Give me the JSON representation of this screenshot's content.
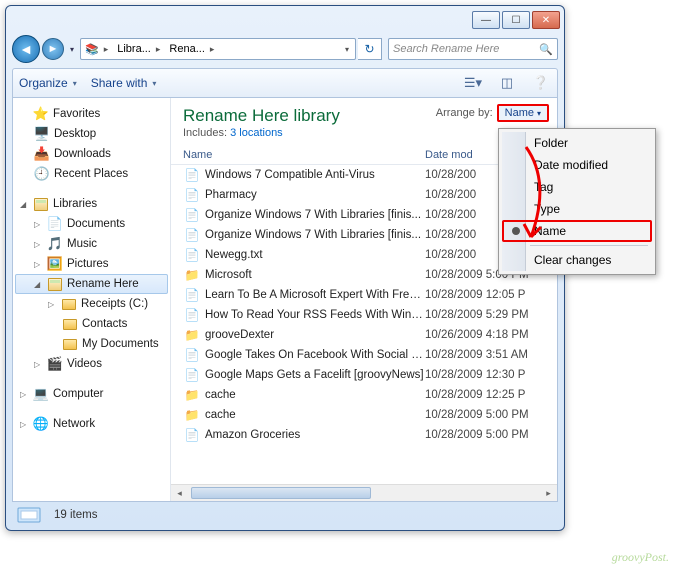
{
  "titlebar": {
    "min": "—",
    "max": "☐",
    "close": "✕"
  },
  "nav": {
    "crumb1": "Libra...",
    "crumb2": "Rena...",
    "search_placeholder": "Search Rename Here"
  },
  "toolbar": {
    "organize": "Organize",
    "share": "Share with"
  },
  "tree": {
    "favorites": "Favorites",
    "desktop": "Desktop",
    "downloads": "Downloads",
    "recent": "Recent Places",
    "libraries": "Libraries",
    "documents": "Documents",
    "music": "Music",
    "pictures": "Pictures",
    "rename_here": "Rename Here",
    "receipts": "Receipts (C:)",
    "contacts": "Contacts",
    "mydocs": "My Documents",
    "videos": "Videos",
    "computer": "Computer",
    "network": "Network"
  },
  "library": {
    "title": "Rename Here library",
    "includes_label": "Includes:",
    "includes_link": "3 locations",
    "arrange_label": "Arrange by:",
    "arrange_value": "Name"
  },
  "columns": {
    "name": "Name",
    "date": "Date mod"
  },
  "files": [
    {
      "name": "Windows 7 Compatible Anti-Virus",
      "date": "10/28/200",
      "icon": "📄"
    },
    {
      "name": "Pharmacy",
      "date": "10/28/200",
      "icon": "📄"
    },
    {
      "name": "Organize Windows 7 With Libraries [finis...",
      "date": "10/28/200",
      "icon": "📄"
    },
    {
      "name": "Organize Windows 7 With Libraries [finis...",
      "date": "10/28/200",
      "icon": "📄"
    },
    {
      "name": "Newegg.txt",
      "date": "10/28/200",
      "icon": "📄"
    },
    {
      "name": "Microsoft",
      "date": "10/28/2009 5:00 PM",
      "icon": "📁"
    },
    {
      "name": "Learn To Be A Microsoft Expert With Free...",
      "date": "10/28/2009 12:05 P",
      "icon": "📄"
    },
    {
      "name": "How To Read Your RSS Feeds With Wind...",
      "date": "10/28/2009 5:29 PM",
      "icon": "📄"
    },
    {
      "name": "grooveDexter",
      "date": "10/26/2009 4:18 PM",
      "icon": "📁"
    },
    {
      "name": "Google Takes On Facebook With Social S...",
      "date": "10/28/2009 3:51 AM",
      "icon": "📄"
    },
    {
      "name": "Google Maps Gets a Facelift [groovyNews]",
      "date": "10/28/2009 12:30 P",
      "icon": "📄"
    },
    {
      "name": "cache",
      "date": "10/28/2009 12:25 P",
      "icon": "📁"
    },
    {
      "name": "cache",
      "date": "10/28/2009 5:00 PM",
      "icon": "📁"
    },
    {
      "name": "Amazon Groceries",
      "date": "10/28/2009 5:00 PM",
      "icon": "📄"
    }
  ],
  "status": {
    "count": "19 items"
  },
  "menu": {
    "folder": "Folder",
    "date_modified": "Date modified",
    "tag": "Tag",
    "type": "Type",
    "name": "Name",
    "clear": "Clear changes"
  },
  "watermark": "groovyPost."
}
